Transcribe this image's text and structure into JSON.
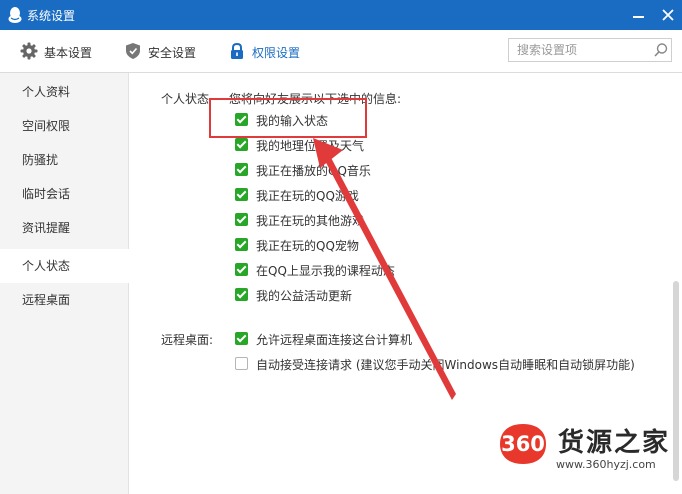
{
  "window": {
    "title": "系统设置"
  },
  "toolbar": {
    "tabs": [
      {
        "label": "基本设置",
        "icon": "gear-icon"
      },
      {
        "label": "安全设置",
        "icon": "shield-icon"
      },
      {
        "label": "权限设置",
        "icon": "lock-icon"
      }
    ],
    "active_tab": "权限设置",
    "search_placeholder": "搜索设置项"
  },
  "sidebar": {
    "items": [
      {
        "label": "个人资料"
      },
      {
        "label": "空间权限"
      },
      {
        "label": "防骚扰"
      },
      {
        "label": "临时会话"
      },
      {
        "label": "资讯提醒"
      },
      {
        "label": "个人状态"
      },
      {
        "label": "远程桌面"
      }
    ],
    "active": "个人状态"
  },
  "personal_status": {
    "label": "个人状态",
    "desc": "您将向好友展示以下选中的信息:",
    "options": [
      {
        "label": "我的输入状态",
        "checked": true
      },
      {
        "label": "我的地理位置及天气",
        "checked": true
      },
      {
        "label": "我正在播放的QQ音乐",
        "checked": true
      },
      {
        "label": "我正在玩的QQ游戏",
        "checked": true
      },
      {
        "label": "我正在玩的其他游戏",
        "checked": true
      },
      {
        "label": "我正在玩的QQ宠物",
        "checked": true
      },
      {
        "label": "在QQ上显示我的课程动态",
        "checked": true
      },
      {
        "label": "我的公益活动更新",
        "checked": true
      }
    ]
  },
  "remote_desktop": {
    "label": "远程桌面:",
    "options": [
      {
        "label": "允许远程桌面连接这台计算机",
        "checked": true
      },
      {
        "label": "自动接受连接请求 (建议您手动关闭Windows自动睡眠和自动锁屏功能)",
        "checked": false
      }
    ]
  },
  "watermark": {
    "badge": "360",
    "title": "货源之家",
    "url": "www.360hyzj.com"
  },
  "colors": {
    "titlebar": "#1a6cc2",
    "checkbox_checked": "#27a627",
    "annotation": "#e03a3a",
    "active_tab": "#1a6cc2"
  }
}
